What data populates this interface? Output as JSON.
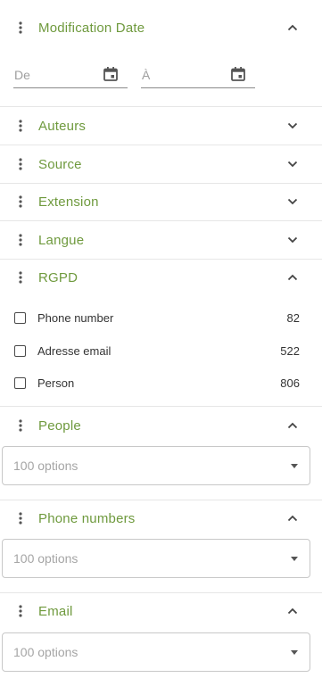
{
  "colors": {
    "accent": "#6f9a3e",
    "text": "#333333",
    "placeholder": "#9e9e9e"
  },
  "sections": {
    "modification_date": {
      "title": "Modification Date",
      "expanded": true,
      "from_placeholder": "De",
      "to_placeholder": "À"
    },
    "auteurs": {
      "title": "Auteurs",
      "expanded": false
    },
    "source": {
      "title": "Source",
      "expanded": false
    },
    "extension": {
      "title": "Extension",
      "expanded": false
    },
    "langue": {
      "title": "Langue",
      "expanded": false
    },
    "rgpd": {
      "title": "RGPD",
      "expanded": true,
      "items": [
        {
          "label": "Phone number",
          "count": "82",
          "checked": false
        },
        {
          "label": "Adresse email",
          "count": "522",
          "checked": false
        },
        {
          "label": "Person",
          "count": "806",
          "checked": false
        }
      ]
    },
    "people": {
      "title": "People",
      "expanded": true,
      "select_placeholder": "100 options"
    },
    "phone_numbers": {
      "title": "Phone numbers",
      "expanded": true,
      "select_placeholder": "100 options"
    },
    "email": {
      "title": "Email",
      "expanded": true,
      "select_placeholder": "100 options"
    }
  },
  "icons": {
    "drag": "drag-handle-icon",
    "expand": "chevron-down-icon",
    "collapse": "chevron-up-icon",
    "calendar": "calendar-icon",
    "dropdown": "caret-down-icon"
  }
}
